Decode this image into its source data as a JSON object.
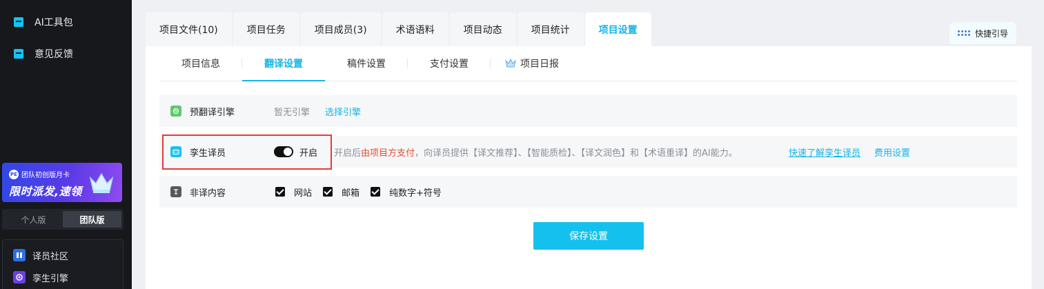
{
  "sidebar": {
    "items": [
      {
        "label": "AI工具包",
        "icon": "toolbox-icon"
      },
      {
        "label": "意见反馈",
        "icon": "feedback-icon"
      }
    ],
    "promo": {
      "badge": "PE",
      "line1": "团队初创版月卡",
      "line2": "限时派发,速领"
    },
    "version_switch": [
      {
        "label": "个人版",
        "active": false
      },
      {
        "label": "团队版",
        "active": true
      }
    ],
    "panel_items": [
      {
        "label": "译员社区",
        "icon": "community-icon"
      },
      {
        "label": "孪生引擎",
        "icon": "engine-icon"
      }
    ]
  },
  "tabs": [
    {
      "label": "项目文件(10)",
      "active": false
    },
    {
      "label": "项目任务",
      "active": false
    },
    {
      "label": "项目成员(3)",
      "active": false
    },
    {
      "label": "术语语料",
      "active": false
    },
    {
      "label": "项目动态",
      "active": false
    },
    {
      "label": "项目统计",
      "active": false
    },
    {
      "label": "项目设置",
      "active": true
    }
  ],
  "guide_label": "快捷引导",
  "subtabs": [
    {
      "label": "项目信息",
      "active": false
    },
    {
      "label": "翻译设置",
      "active": true
    },
    {
      "label": "稿件设置",
      "active": false
    },
    {
      "label": "支付设置",
      "active": false
    },
    {
      "label": "项目日报",
      "active": false,
      "icon": "crown-icon"
    }
  ],
  "settings": {
    "engine": {
      "label": "预翻译引擎",
      "value": "暂无引擎",
      "action": "选择引擎"
    },
    "twin": {
      "label": "孪生译员",
      "toggle_state": "开启",
      "desc_prefix": "开启后",
      "desc_highlight": "由项目方支付",
      "desc_suffix": "，向译员提供【译文推荐】、【智能质检】、【译文润色】和【术语重译】的AI能力。",
      "learn_link": "快速了解孪生译员",
      "fee_link": "费用设置"
    },
    "nontranslate": {
      "label": "非译内容",
      "options": [
        {
          "label": "网站",
          "checked": true
        },
        {
          "label": "邮箱",
          "checked": true
        },
        {
          "label": "纯数字+符号",
          "checked": true
        }
      ]
    }
  },
  "save_label": "保存设置",
  "colors": {
    "accent": "#14b5e4",
    "highlight_red": "#e54d2e",
    "annotation_red": "#e53935"
  }
}
